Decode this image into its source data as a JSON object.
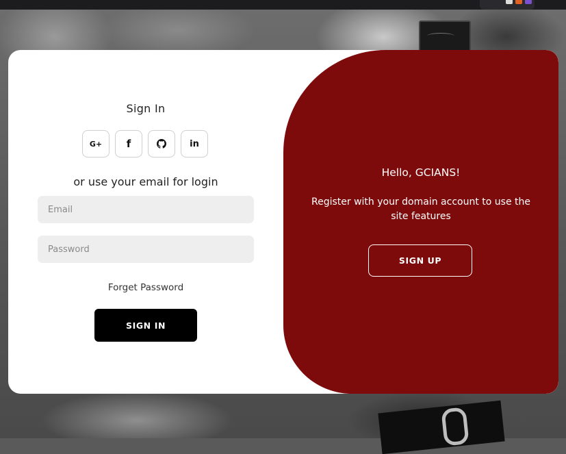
{
  "signin": {
    "title": "Sign In",
    "socials": [
      {
        "icon": "google-plus-icon",
        "label": "G+"
      },
      {
        "icon": "facebook-icon",
        "label": "f"
      },
      {
        "icon": "github-icon",
        "label": ""
      },
      {
        "icon": "linkedin-icon",
        "label": "in"
      }
    ],
    "alt_text": "or use your email for login",
    "email_placeholder": "Email",
    "password_placeholder": "Password",
    "forgot_label": "Forget Password",
    "button_label": "SIGN IN"
  },
  "signup_panel": {
    "greeting": "Hello, GCIANS!",
    "message": "Register with your domain account to use the site features",
    "button_label": "SIGN UP"
  },
  "colors": {
    "accent": "#7e0b0b",
    "primary_button": "#000000",
    "input_bg": "#eeeeee"
  }
}
